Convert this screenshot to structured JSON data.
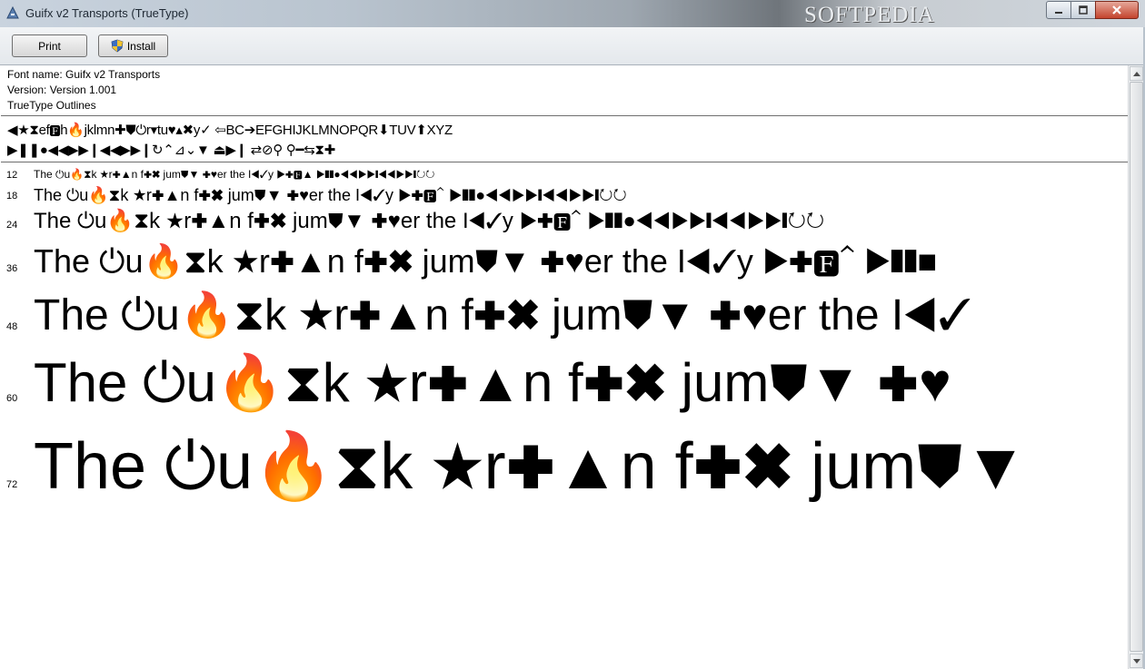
{
  "window": {
    "title": "Guifx v2 Transports (TrueType)",
    "watermark": "SOFTPEDIA",
    "controls": {
      "minimize": "▁",
      "maximize": "☐",
      "close": "✕"
    }
  },
  "toolbar": {
    "print_label": "Print",
    "install_label": "Install",
    "install_icon": "shield-icon"
  },
  "font_info": {
    "name_line": "Font name: Guifx v2 Transports",
    "version_line": "Version: Version 1.001",
    "outline_line": "TrueType Outlines"
  },
  "charset": {
    "line1": "◀★⧗ef🅵h🔥jklmn✚⛊⏻r▾tu♥▴✖y✓ ⇦BC➔EFGHIJKLMNOPQR⬇TUV⬆XYZ",
    "line2": "▶❚❚●◀◀▶▶❙◀◀▶▶❙↻⌃⊿⌄▼ ⏏▶❙ ⇄⊘⚲ ⚲━⇆⧗✚"
  },
  "samples": [
    {
      "size": "12",
      "text": "The ⏻u🔥⧗k ★r✚▲n f✚✖ jum⛊▼ ✚♥er the I◀✓y ▶✚🅵▲ ▶❚❚●◀◀▶▶❙◀◀▶▶❙↻↻"
    },
    {
      "size": "18",
      "text": "The ⏻u🔥⧗k ★r✚▲n f✚✖ jum⛊▼ ✚♥er the I◀✓y ▶✚🅵⌃ ▶❚❚●◀◀▶▶❙◀◀▶▶❙↻↻"
    },
    {
      "size": "24",
      "text": "The ⏻u🔥⧗k ★r✚▲n f✚✖ jum⛊▼ ✚♥er the I◀✓y ▶✚🅵⌃ ▶❚❚●◀◀▶▶❙◀◀▶▶❙↻↻"
    },
    {
      "size": "36",
      "text": "The ⏻u🔥⧗k ★r✚▲n f✚✖ jum⛊▼ ✚♥er the I◀✓y ▶✚🅵⌃ ▶❚❚■"
    },
    {
      "size": "48",
      "text": "The ⏻u🔥⧗k ★r✚▲n f✚✖ jum⛊▼ ✚♥er the I◀✓"
    },
    {
      "size": "60",
      "text": "The ⏻u🔥⧗k ★r✚▲n f✚✖ jum⛊▼ ✚♥"
    },
    {
      "size": "72",
      "text": "The ⏻u🔥⧗k ★r✚▲n f✚✖ jum⛊▼"
    }
  ]
}
